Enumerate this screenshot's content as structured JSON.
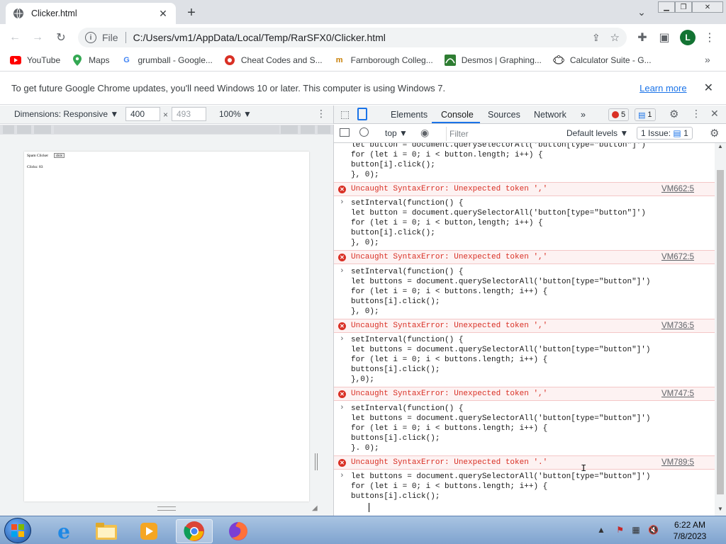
{
  "browser": {
    "tab_title": "Clicker.html",
    "address_protocol": "File",
    "address_url": "C:/Users/vm1/AppData/Local/Temp/RarSFX0/Clicker.html",
    "profile_initial": "L",
    "bookmarks": [
      {
        "label": "YouTube",
        "icon": "youtube-icon",
        "color": "#ff0000"
      },
      {
        "label": "Maps",
        "icon": "maps-icon",
        "color": "#34a853"
      },
      {
        "label": "grumball - Google...",
        "icon": "google-icon",
        "color": "#4285f4"
      },
      {
        "label": "Cheat Codes and S...",
        "icon": "cheat-codes-icon",
        "color": "#d93025"
      },
      {
        "label": "Farnborough Colleg...",
        "icon": "farnborough-icon",
        "color": "#c77d00"
      },
      {
        "label": "Desmos | Graphing...",
        "icon": "desmos-icon",
        "color": "#2e7d32"
      },
      {
        "label": "Calculator Suite - G...",
        "icon": "geogebra-icon",
        "color": "#555555"
      }
    ],
    "infobar": {
      "message": "To get future Google Chrome updates, you'll need Windows 10 or later. This computer is using Windows 7.",
      "link": "Learn more"
    }
  },
  "device_toolbar": {
    "dimensions_label": "Dimensions: Responsive ▼",
    "width": "400",
    "height": "493",
    "times": "×",
    "zoom": "100% ▼"
  },
  "page_preview": {
    "title": "Spam Clicker",
    "button": "click",
    "clicks": "Clicks: 83"
  },
  "devtools": {
    "tabs": [
      "Elements",
      "Console",
      "Sources",
      "Network"
    ],
    "more": "»",
    "error_count": "5",
    "issue_count": "1",
    "context": "top ▼",
    "filter_placeholder": "Filter",
    "levels": "Default levels ▼",
    "issues_label": "1 Issue:",
    "issues_num": "1"
  },
  "console": {
    "entries": [
      {
        "code": "let button = document.querySelectorAll('button[type=\"button\"]')\nfor (let i = 0; i < button.length; i++) {\nbutton[i].click();\n}, 0);"
      },
      {
        "error": "Uncaught SyntaxError: Unexpected token ','",
        "source": "VM662:5"
      },
      {
        "code": "setInterval(function() {\nlet button = document.querySelectorAll('button[type=\"button\"]')\nfor (let i = 0; i < button,length; i++) {\nbutton[i].click();\n}, 0);"
      },
      {
        "error": "Uncaught SyntaxError: Unexpected token ','",
        "source": "VM672:5"
      },
      {
        "code": "setInterval(function() {\nlet buttons = document.querySelectorAll('button[type=\"button\"]')\nfor (let i = 0; i < buttons.length; i++) {\nbuttons[i].click();\n}, 0);"
      },
      {
        "error": "Uncaught SyntaxError: Unexpected token ','",
        "source": "VM736:5"
      },
      {
        "code": "setInterval(function() {\nlet buttons = document.querySelectorAll('button[type=\"button\"]')\nfor (let i = 0; i < buttons.length; i++) {\nbuttons[i].click();\n},0);"
      },
      {
        "error": "Uncaught SyntaxError: Unexpected token ','",
        "source": "VM747:5"
      },
      {
        "code": "setInterval(function() {\nlet buttons = document.querySelectorAll('button[type=\"button\"]')\nfor (let i = 0; i < buttons.length; i++) {\nbuttons[i].click();\n}. 0);"
      },
      {
        "error": "Uncaught SyntaxError: Unexpected token '.'",
        "source": "VM789:5"
      },
      {
        "code": "let buttons = document.querySelectorAll('button[type=\"button\"]')\nfor (let i = 0; i < buttons.length; i++) {\nbuttons[i].click();"
      }
    ]
  },
  "taskbar": {
    "time": "6:22 AM",
    "date": "7/8/2023"
  }
}
